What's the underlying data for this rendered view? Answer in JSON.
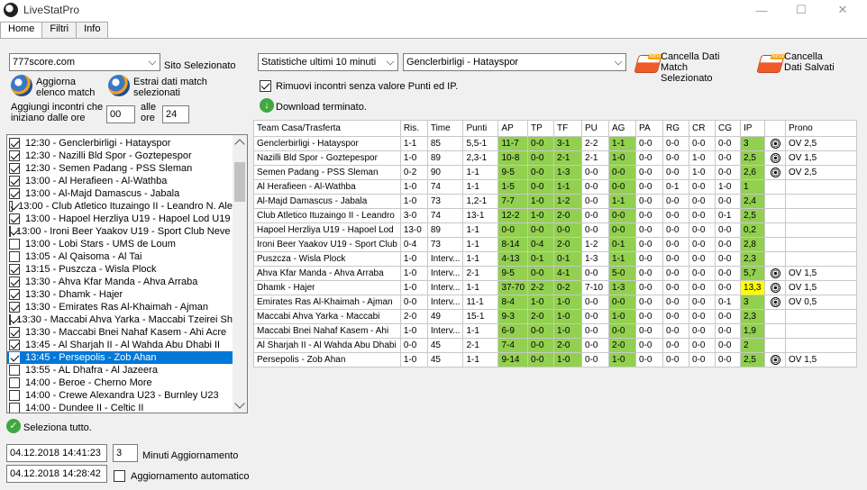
{
  "window": {
    "title": "LiveStatPro"
  },
  "tabs": [
    {
      "label": "Home"
    },
    {
      "label": "Filtri"
    },
    {
      "label": "Info"
    }
  ],
  "left": {
    "site_combo": "777score.com",
    "site_label": "Sito Selezionato",
    "refresh_label": "Aggiorna elenco match",
    "extract_label": "Estrai dati match selezionati",
    "add_label": "Aggiungi incontri che iniziano dalle ore",
    "from_value": "00",
    "alle_label": "alle ore",
    "to_value": "24",
    "select_all": "Seleziona tutto.",
    "date1": "04.12.2018 14:41:23",
    "minutes_value": "3",
    "minutes_label": "Minuti Aggiornamento",
    "date2": "04.12.2018 14:28:42",
    "auto_label": "Aggiornamento automatico"
  },
  "matches": [
    {
      "text": "12:30 - Genclerbirligi - Hatayspor",
      "checked": true
    },
    {
      "text": "12:30 - Nazilli Bld Spor - Goztepespor",
      "checked": true
    },
    {
      "text": "12:30 - Semen Padang - PSS Sleman",
      "checked": true
    },
    {
      "text": "13:00 - Al Herafieen - Al-Wathba",
      "checked": true
    },
    {
      "text": "13:00 - Al-Majd Damascus - Jabala",
      "checked": true
    },
    {
      "text": "13:00 - Club Atletico Ituzaingo II - Leandro N. Ale",
      "checked": true
    },
    {
      "text": "13:00 - Hapoel Herzliya U19 - Hapoel Lod U19",
      "checked": true
    },
    {
      "text": "13:00 - Ironi Beer Yaakov U19 - Sport Club Neve Y",
      "checked": true
    },
    {
      "text": "13:00 - Lobi Stars - UMS de Loum",
      "checked": false
    },
    {
      "text": "13:05 - Al Qaisoma - Al Tai",
      "checked": false
    },
    {
      "text": "13:15 - Puszcza - Wisla Plock",
      "checked": true
    },
    {
      "text": "13:30 - Ahva Kfar Manda - Ahva Arraba",
      "checked": true
    },
    {
      "text": "13:30 - Dhamk - Hajer",
      "checked": true
    },
    {
      "text": "13:30 - Emirates Ras Al-Khaimah - Ajman",
      "checked": true
    },
    {
      "text": "13:30 - Maccabi Ahva Yarka - Maccabi Tzeirei Sh",
      "checked": true
    },
    {
      "text": "13:30 - Maccabi Bnei Nahaf Kasem - Ahi Acre",
      "checked": true
    },
    {
      "text": "13:45 - Al Sharjah II - Al Wahda Abu Dhabi II",
      "checked": true
    },
    {
      "text": "13:45 - Persepolis - Zob Ahan",
      "checked": true,
      "selected": true
    },
    {
      "text": "13:55 - AL Dhafra - Al Jazeera",
      "checked": false
    },
    {
      "text": "14:00 - Beroe - Cherno More",
      "checked": false
    },
    {
      "text": "14:00 - Crewe Alexandra U23 - Burnley U23",
      "checked": false
    },
    {
      "text": "14:00 - Dundee II - Celtic II",
      "checked": false
    }
  ],
  "right": {
    "stats_combo": "Statistiche ultimi 10 minuti",
    "match_combo": "Genclerbirligi - Hatayspor",
    "clear_selected": "Cancella Dati Match Selezionato",
    "clear_saved": "Cancella Dati Salvati",
    "remove_label": "Rimuovi incontri senza valore Punti ed IP.",
    "download_label": "Download terminato."
  },
  "table": {
    "headers": [
      "Team Casa/Trasferta",
      "Ris.",
      "Time",
      "Punti",
      "AP",
      "TP",
      "TF",
      "PU",
      "AG",
      "PA",
      "RG",
      "CR",
      "CG",
      "IP",
      "",
      "Prono"
    ],
    "rows": [
      [
        "Genclerbirligi - Hatayspor",
        "1-1",
        "85",
        "5,5-1",
        "11-7",
        "0-0",
        "3-1",
        "2-2",
        "1-1",
        "0-0",
        "0-0",
        "0-0",
        "0-0",
        "3",
        "ball",
        "OV 2,5"
      ],
      [
        "Nazilli Bld Spor - Goztepespor",
        "1-0",
        "89",
        "2,3-1",
        "10-8",
        "0-0",
        "2-1",
        "2-1",
        "1-0",
        "0-0",
        "0-0",
        "1-0",
        "0-0",
        "2,5",
        "ball",
        "OV 1,5"
      ],
      [
        "Semen Padang - PSS Sleman",
        "0-2",
        "90",
        "1-1",
        "9-5",
        "0-0",
        "1-3",
        "0-0",
        "0-0",
        "0-0",
        "0-0",
        "1-0",
        "0-0",
        "2,6",
        "ball",
        "OV 2,5"
      ],
      [
        "Al Herafieen - Al-Wathba",
        "1-0",
        "74",
        "1-1",
        "1-5",
        "0-0",
        "1-1",
        "0-0",
        "0-0",
        "0-0",
        "0-1",
        "0-0",
        "1-0",
        "1",
        "",
        ""
      ],
      [
        "Al-Majd Damascus - Jabala",
        "1-0",
        "73",
        "1,2-1",
        "7-7",
        "1-0",
        "1-2",
        "0-0",
        "1-1",
        "0-0",
        "0-0",
        "0-0",
        "0-0",
        "2,4",
        "",
        ""
      ],
      [
        "Club Atletico Ituzaingo II - Leandro",
        "3-0",
        "74",
        "13-1",
        "12-2",
        "1-0",
        "2-0",
        "0-0",
        "0-0",
        "0-0",
        "0-0",
        "0-0",
        "0-1",
        "2,5",
        "",
        ""
      ],
      [
        "Hapoel Herzliya U19 - Hapoel Lod",
        "13-0",
        "89",
        "1-1",
        "0-0",
        "0-0",
        "0-0",
        "0-0",
        "0-0",
        "0-0",
        "0-0",
        "0-0",
        "0-0",
        "0,2",
        "",
        ""
      ],
      [
        "Ironi Beer Yaakov U19 - Sport Club",
        "0-4",
        "73",
        "1-1",
        "8-14",
        "0-4",
        "2-0",
        "1-2",
        "0-1",
        "0-0",
        "0-0",
        "0-0",
        "0-0",
        "2,8",
        "",
        ""
      ],
      [
        "Puszcza - Wisla Plock",
        "1-0",
        "Interv...",
        "1-1",
        "4-13",
        "0-1",
        "0-1",
        "1-3",
        "1-1",
        "0-0",
        "0-0",
        "0-0",
        "0-0",
        "2,3",
        "",
        ""
      ],
      [
        "Ahva Kfar Manda - Ahva Arraba",
        "1-0",
        "Interv...",
        "2-1",
        "9-5",
        "0-0",
        "4-1",
        "0-0",
        "5-0",
        "0-0",
        "0-0",
        "0-0",
        "0-0",
        "5,7",
        "ball",
        "OV 1,5"
      ],
      [
        "Dhamk - Hajer",
        "1-0",
        "Interv...",
        "1-1",
        "37-70",
        "2-2",
        "0-2",
        "7-10",
        "1-3",
        "0-0",
        "0-0",
        "0-0",
        "0-0",
        "13,3",
        "ball",
        "OV 1,5"
      ],
      [
        "Emirates Ras Al-Khaimah - Ajman",
        "0-0",
        "Interv...",
        "11-1",
        "8-4",
        "1-0",
        "1-0",
        "0-0",
        "0-0",
        "0-0",
        "0-0",
        "0-0",
        "0-1",
        "3",
        "ball",
        "OV 0,5"
      ],
      [
        "Maccabi Ahva Yarka - Maccabi",
        "2-0",
        "49",
        "15-1",
        "9-3",
        "2-0",
        "1-0",
        "0-0",
        "1-0",
        "0-0",
        "0-0",
        "0-0",
        "0-0",
        "2,3",
        "",
        ""
      ],
      [
        "Maccabi Bnei Nahaf Kasem - Ahi",
        "1-0",
        "Interv...",
        "1-1",
        "6-9",
        "0-0",
        "1-0",
        "0-0",
        "0-0",
        "0-0",
        "0-0",
        "0-0",
        "0-0",
        "1,9",
        "",
        ""
      ],
      [
        "Al Sharjah II - Al Wahda Abu Dhabi",
        "0-0",
        "45",
        "2-1",
        "7-4",
        "0-0",
        "2-0",
        "0-0",
        "2-0",
        "0-0",
        "0-0",
        "0-0",
        "0-0",
        "2",
        "",
        ""
      ],
      [
        "Persepolis - Zob Ahan",
        "1-0",
        "45",
        "1-1",
        "9-14",
        "0-0",
        "1-0",
        "0-0",
        "1-0",
        "0-0",
        "0-0",
        "0-0",
        "0-0",
        "2,5",
        "ball",
        "OV 1,5"
      ]
    ]
  }
}
